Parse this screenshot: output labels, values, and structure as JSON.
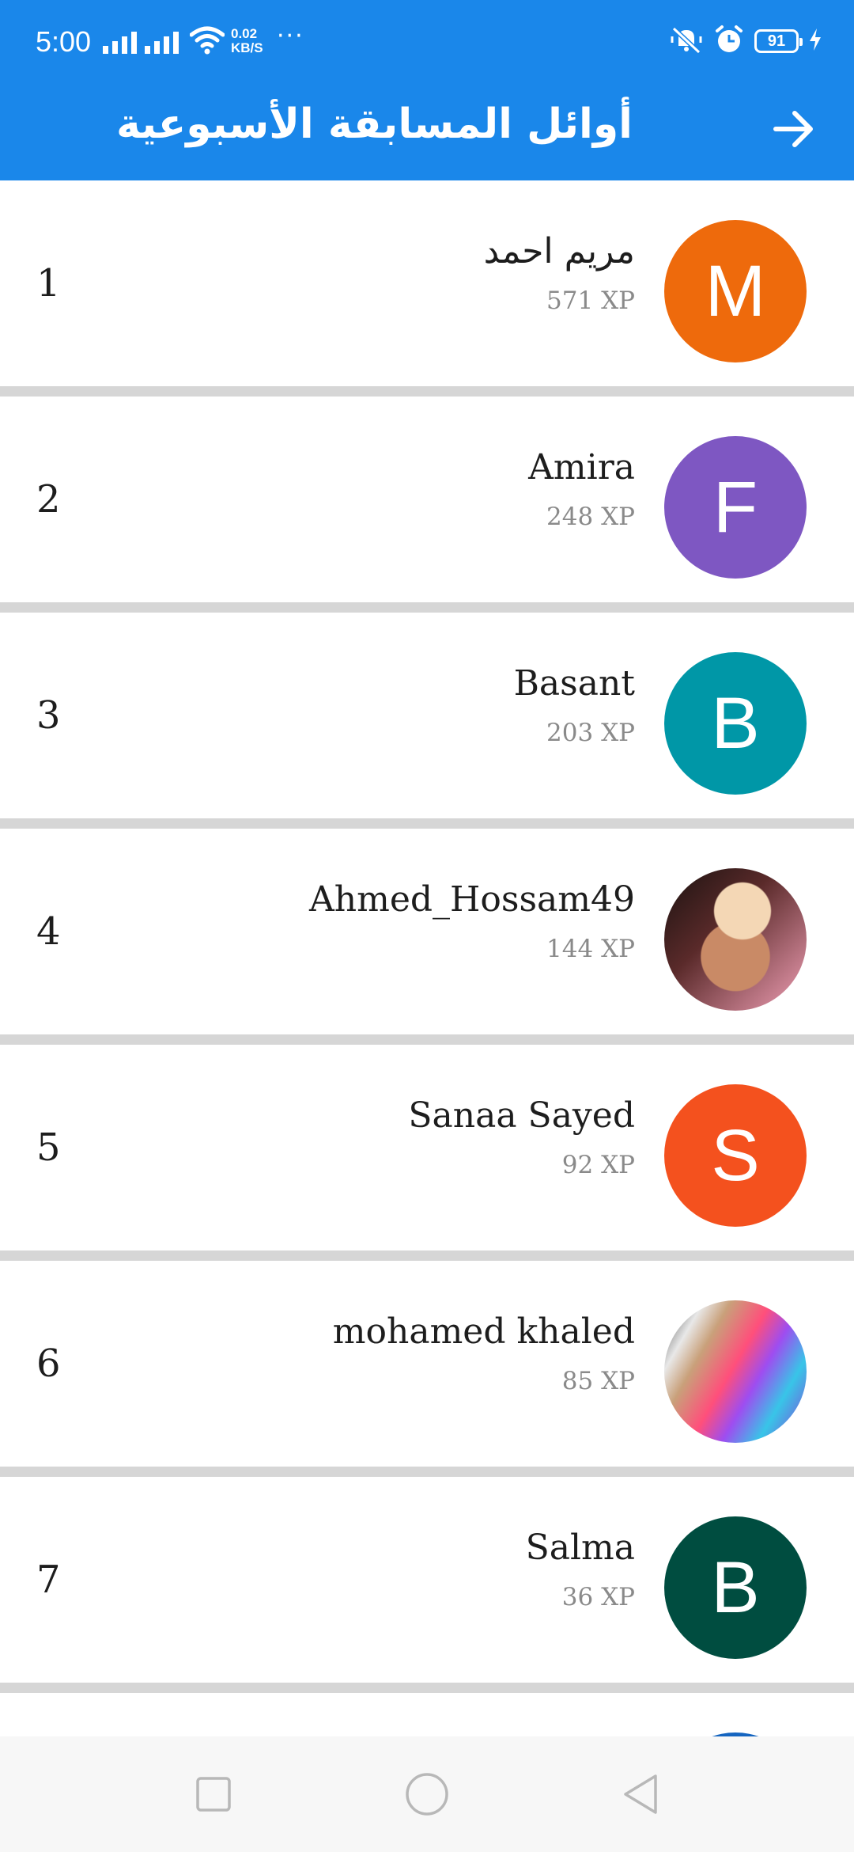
{
  "status_bar": {
    "time": "5:00",
    "net_speed_value": "0.02",
    "net_speed_unit": "KB/S",
    "more_dots": "···",
    "battery_level": "91"
  },
  "app_bar": {
    "title": "أوائل المسابقة الأسبوعية",
    "back_icon": "arrow-right-icon"
  },
  "leaderboard": [
    {
      "rank": "1",
      "name": "مريم احمد",
      "xp": "571 XP",
      "avatar_letter": "M",
      "avatar_color": "#ee6a0c"
    },
    {
      "rank": "2",
      "name": "Amira",
      "xp": "248 XP",
      "avatar_letter": "F",
      "avatar_color": "#7e57c2"
    },
    {
      "rank": "3",
      "name": "Basant",
      "xp": "203 XP",
      "avatar_letter": "B",
      "avatar_color": "#0097a7"
    },
    {
      "rank": "4",
      "name": "Ahmed_Hossam49",
      "xp": "144 XP",
      "avatar_letter": "",
      "avatar_color": ""
    },
    {
      "rank": "5",
      "name": "Sanaa Sayed",
      "xp": "92 XP",
      "avatar_letter": "S",
      "avatar_color": "#f4511e"
    },
    {
      "rank": "6",
      "name": "mohamed khaled",
      "xp": "85 XP",
      "avatar_letter": "",
      "avatar_color": ""
    },
    {
      "rank": "7",
      "name": "Salma",
      "xp": "36 XP",
      "avatar_letter": "B",
      "avatar_color": "#004d40"
    }
  ],
  "nav_bar": {
    "recents_icon": "square-icon",
    "home_icon": "circle-icon",
    "back_icon": "triangle-back-icon"
  }
}
